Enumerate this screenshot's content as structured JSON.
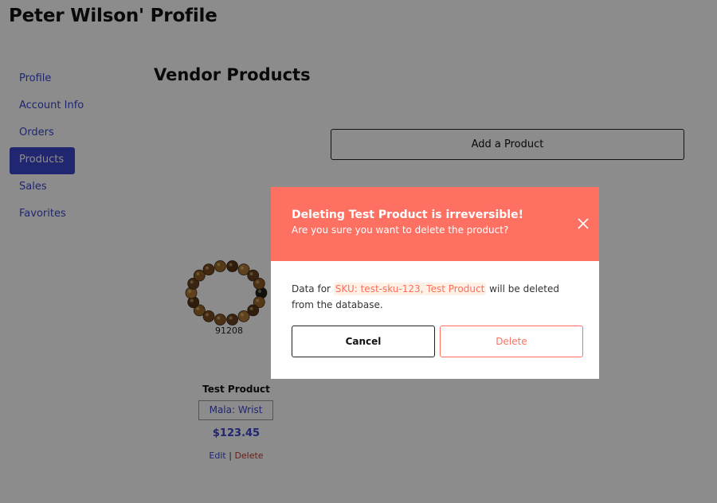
{
  "page": {
    "title": "Peter Wilson' Profile"
  },
  "sidebar": {
    "items": [
      {
        "label": "Profile"
      },
      {
        "label": "Account Info"
      },
      {
        "label": "Orders"
      },
      {
        "label": "Products",
        "active": true
      },
      {
        "label": "Sales"
      },
      {
        "label": "Favorites"
      }
    ]
  },
  "main": {
    "section_title": "Vendor Products",
    "add_product_label": "Add a Product"
  },
  "product": {
    "image_icon": "bead-bracelet-image",
    "sku_number": "91208",
    "name": "Test Product",
    "category": "Mala: Wrist",
    "price": "$123.45",
    "edit_label": "Edit",
    "separator": "|",
    "delete_label": "Delete"
  },
  "modal": {
    "title": "Deleting Test Product is irreversible!",
    "subtitle": "Are you sure you want to delete the product?",
    "close_icon": "close-icon",
    "body_prefix": "Data for",
    "body_highlight": "SKU: test-sku-123, Test Product",
    "body_suffix": "will be deleted from the database.",
    "cancel_label": "Cancel",
    "delete_label": "Delete"
  },
  "colors": {
    "accent": "#3b45cc",
    "danger": "#fe7062",
    "overlay": "rgba(0,0,0,0.45)"
  }
}
